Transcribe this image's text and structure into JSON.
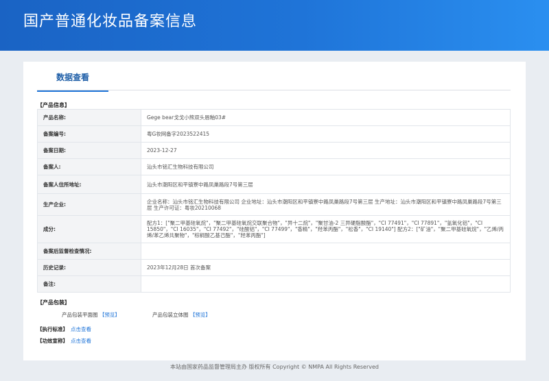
{
  "header": {
    "title": "国产普通化妆品备案信息"
  },
  "tab": {
    "label": "数据查看"
  },
  "product_section": {
    "title": "【产品信息】"
  },
  "rows": [
    {
      "label": "产品名称:",
      "value": "Gege bear戈戈小熊双头唇釉03#"
    },
    {
      "label": "备案编号:",
      "value": "粤G妆网备字2023522415"
    },
    {
      "label": "备案日期:",
      "value": "2023-12-27"
    },
    {
      "label": "备案人:",
      "value": "汕头市铭汇生物科技有限公司"
    },
    {
      "label": "备案人住所地址:",
      "value": "汕头市潮阳区和平镇寮中路凤巢路段7号第三层"
    },
    {
      "label": "生产企业:",
      "value": "企业名称：汕头市铭汇生物科技有限公司 企业地址：汕头市潮阳区和平镇寮中路凤巢路段7号第三层 生产地址：汕头市潮阳区和平镇寮中路凤巢路段7号第三层 生产许可证：粤妆20210068"
    },
    {
      "label": "成分:",
      "value": "配方1：[\"聚二甲基硅氧烷\"，\"聚二甲基硅氧烷交联聚合物\"，\"异十二烷\"，\"聚甘油-2 三异硬脂酸酯\"，\"CI 77491\"，\"CI 77891\"，\"氢氧化铝\"，\"CI 15850\"，\"CI 16035\"，\"CI 77492\"，\"硅酸铝\"，\"CI 77499\"，\"香精\"，\"羟苯丙酯\"，\"松香\"，\"CI 19140\"] 配方2：[\"矿油\"，\"聚二甲基硅氧烷\"，\"乙烯/丙烯/苯乙烯共聚物\"，\"棕榈酸乙基己酯\"，\"羟苯丙酯\"]"
    },
    {
      "label": "备案后监督检查情况:",
      "value": ""
    },
    {
      "label": "历史记录:",
      "value": "2023年12月28日 首次备案"
    },
    {
      "label": "备注:",
      "value": ""
    }
  ],
  "packaging": {
    "title": "【产品包装】",
    "flat_label": "产品包装平面图",
    "flat_link": "【预览】",
    "solid_label": "产品包装立体图",
    "solid_link": "【预览】"
  },
  "standard": {
    "label": "【执行标准】",
    "link": "点击查看"
  },
  "efficacy": {
    "label": "【功效宣称】",
    "link": "点击查看"
  },
  "footer": {
    "text": "本站由国家药品监督管理局主办 版权所有 Copyright © NMPA All Rights Reserved"
  }
}
